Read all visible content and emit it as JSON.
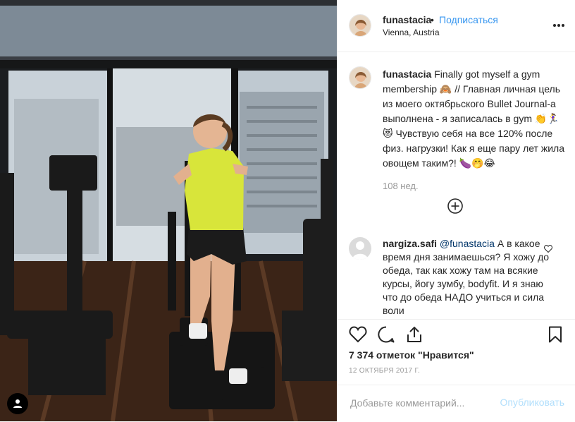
{
  "post": {
    "username": "funastacia",
    "separator": "•",
    "follow_label": "Подписаться",
    "location": "Vienna, Austria",
    "caption_text": "Finally got myself a gym membership 🙈 // Главная личная цель из моего октябрьского Bullet Journal-а выполнена - я записалась в gym 👏🏃‍♀️😻 Чувствую себя на все 120% после физ. нагрузки! Как я еще пару лет жила овощем таким?! 🍆🤭😂",
    "caption_time": "108 нед.",
    "likes": "7 374 отметок \"Нравится\"",
    "date": "12 ОКТЯБРЯ 2017 Г."
  },
  "comments": [
    {
      "username": "nargiza.safi",
      "mention": "@funastacia",
      "text": "А в какое время дня занимаешься? Я хожу до обеда, так как хожу там на всякие курсы, йогу зумбу, bodyfit. И я знаю что до обеда НАДО учиться и сила воли"
    }
  ],
  "add_comment": {
    "placeholder": "Добавьте комментарий...",
    "publish_label": "Опубликовать"
  },
  "icons": {
    "more": "more-icon",
    "load_more": "plus-circle-icon",
    "comment_like": "heart-icon",
    "like": "heart-icon",
    "comment": "comment-icon",
    "share": "share-icon",
    "save": "bookmark-icon",
    "tag": "user-tag-icon"
  },
  "colors": {
    "link": "#3897f0",
    "publish_disabled": "#b2dffc",
    "shirt": "#d8e53a"
  }
}
